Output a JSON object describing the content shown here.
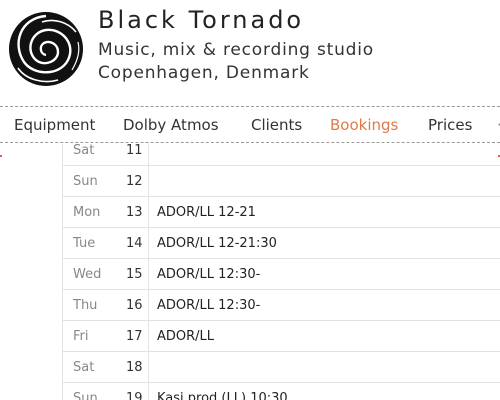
{
  "header": {
    "title": "Black Tornado",
    "subtitle_1": "Music, mix & recording studio",
    "subtitle_2": "Copenhagen, Denmark"
  },
  "nav": {
    "items": [
      {
        "label": "Equipment",
        "active": false
      },
      {
        "label": "Dolby Atmos",
        "active": false
      },
      {
        "label": "Clients",
        "active": false
      },
      {
        "label": "Bookings",
        "active": true
      },
      {
        "label": "Prices",
        "active": false
      }
    ],
    "active_color": "#e07a4a"
  },
  "schedule": {
    "rows": [
      {
        "day": "Sat",
        "date": "11",
        "booking": ""
      },
      {
        "day": "Sun",
        "date": "12",
        "booking": ""
      },
      {
        "day": "Mon",
        "date": "13",
        "booking": "ADOR/LL 12-21"
      },
      {
        "day": "Tue",
        "date": "14",
        "booking": "ADOR/LL 12-21:30"
      },
      {
        "day": "Wed",
        "date": "15",
        "booking": "ADOR/LL 12:30-"
      },
      {
        "day": "Thu",
        "date": "16",
        "booking": "ADOR/LL 12:30-"
      },
      {
        "day": "Fri",
        "date": "17",
        "booking": "ADOR/LL"
      },
      {
        "day": "Sat",
        "date": "18",
        "booking": ""
      },
      {
        "day": "Sun",
        "date": "19",
        "booking": "Kasi prod (LL) 10:30"
      }
    ]
  }
}
